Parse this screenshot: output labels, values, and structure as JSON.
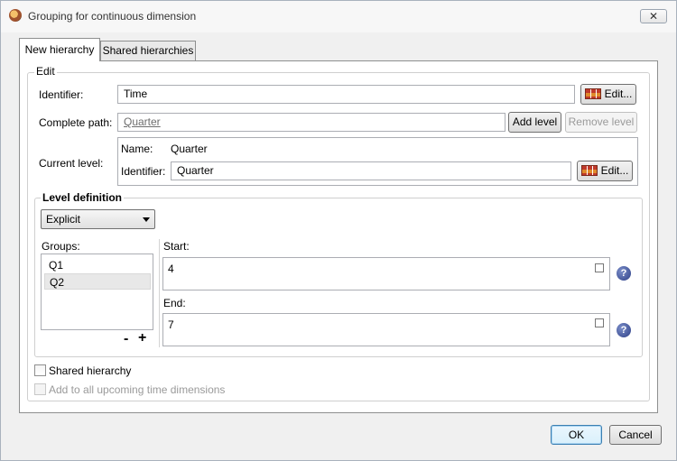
{
  "window": {
    "title": "Grouping for continuous dimension",
    "close_symbol": "✕"
  },
  "tabs": [
    {
      "label": "New hierarchy"
    },
    {
      "label": "Shared hierarchies"
    }
  ],
  "edit": {
    "legend": "Edit",
    "identifier_label": "Identifier:",
    "identifier_value": "Time",
    "edit_button": "Edit...",
    "path_label": "Complete path:",
    "path_value": "Quarter",
    "add_level": "Add level",
    "remove_level": "Remove level",
    "current_level_label": "Current level:",
    "current_level": {
      "name_label": "Name:",
      "name_value": "Quarter",
      "identifier_label": "Identifier:",
      "identifier_value": "Quarter",
      "edit_button": "Edit..."
    }
  },
  "level_definition": {
    "legend": "Level definition",
    "type_selected": "Explicit",
    "groups_label": "Groups:",
    "groups": [
      "Q1",
      "Q2"
    ],
    "selected_group": "Q2",
    "remove_symbol": "-",
    "add_symbol": "+",
    "start_label": "Start:",
    "start_value": "4",
    "end_label": "End:",
    "end_value": "7",
    "help_symbol": "?"
  },
  "options": {
    "shared_hierarchy": {
      "label": "Shared hierarchy",
      "checked": false
    },
    "add_to_upcoming": {
      "label": "Add to all upcoming time dimensions",
      "checked": false,
      "enabled": false
    }
  },
  "footer": {
    "ok": "OK",
    "cancel": "Cancel"
  },
  "colors": {
    "window_bg": "#f0f0f0",
    "ok_border": "#3c7fb1",
    "link_text": "#6d6d6d"
  }
}
